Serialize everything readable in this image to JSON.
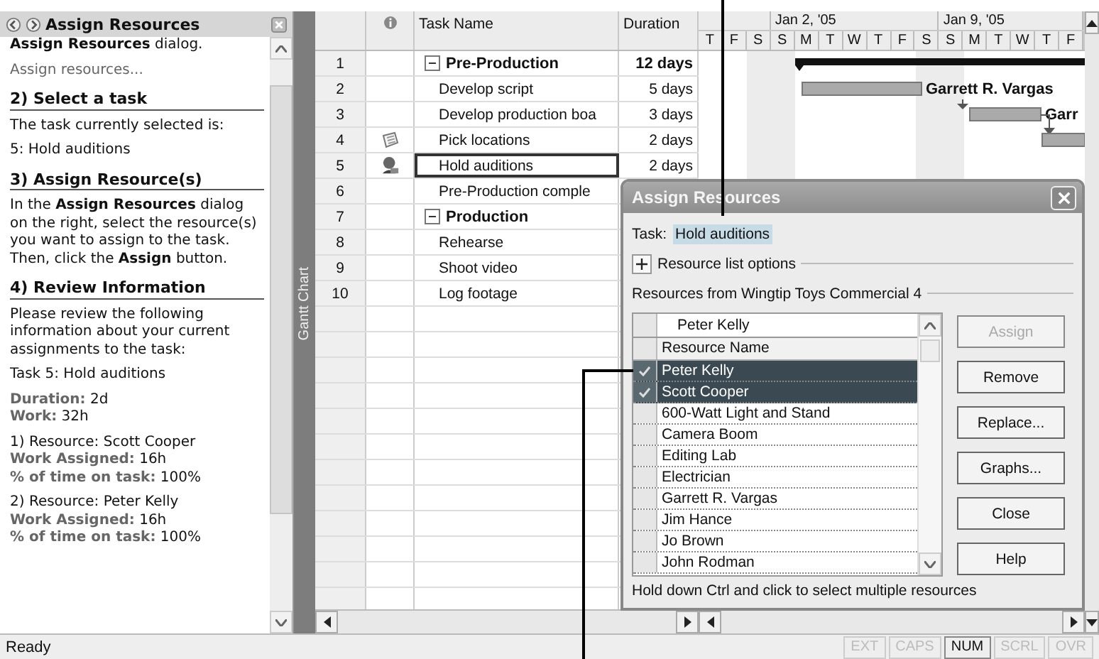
{
  "task_pane": {
    "title": "Assign Resources",
    "blocks": [
      {
        "kind": "text",
        "text": "**Assign Resources** dialog."
      },
      {
        "kind": "link",
        "text": "Assign resources..."
      },
      {
        "kind": "heading",
        "text": "2) Select a task"
      },
      {
        "kind": "text",
        "text": "The task currently selected is:"
      },
      {
        "kind": "text",
        "text": "5: Hold auditions"
      },
      {
        "kind": "heading",
        "text": "3) Assign Resource(s)"
      },
      {
        "kind": "text",
        "text": "In the **Assign Resources** dialog on the right, select the resource(s) you want to assign to the task. Then, click the **Assign** button."
      },
      {
        "kind": "heading",
        "text": "4) Review Information"
      },
      {
        "kind": "text",
        "text": "Please review the following information about your current assignments to the task:"
      },
      {
        "kind": "text",
        "text": "Task 5: Hold auditions"
      },
      {
        "kind": "lines",
        "lines": [
          "**Duration:** 2d",
          "**Work:** 32h"
        ]
      },
      {
        "kind": "lines",
        "lines": [
          "1) Resource: Scott Cooper",
          "**Work Assigned:** 16h",
          "**% of time on task:** 100%"
        ]
      },
      {
        "kind": "lines",
        "lines": [
          "2) Resource: Peter Kelly",
          "**Work Assigned:** 16h",
          "**% of time on task:** 100%"
        ]
      }
    ]
  },
  "view_bar": {
    "label": "Gantt Chart"
  },
  "table": {
    "columns": [
      "Task Name",
      "Duration"
    ],
    "rows": [
      {
        "id": "1",
        "kind": "summary",
        "name": "Pre-Production",
        "duration": "12 days",
        "expanded": true,
        "has_note": false,
        "has_assignment": false,
        "selected": false
      },
      {
        "id": "2",
        "kind": "task",
        "name": "Develop script",
        "duration": "5 days",
        "has_note": false,
        "has_assignment": false,
        "selected": false
      },
      {
        "id": "3",
        "kind": "task",
        "name": "Develop production boa",
        "duration": "3 days",
        "has_note": false,
        "has_assignment": false,
        "selected": false
      },
      {
        "id": "4",
        "kind": "task",
        "name": "Pick locations",
        "duration": "2 days",
        "has_note": true,
        "has_assignment": false,
        "selected": false
      },
      {
        "id": "5",
        "kind": "task",
        "name": "Hold auditions",
        "duration": "2 days",
        "has_note": false,
        "has_assignment": true,
        "selected": true
      },
      {
        "id": "6",
        "kind": "task",
        "name": "Pre-Production comple",
        "has_note": false,
        "has_assignment": false,
        "selected": false
      },
      {
        "id": "7",
        "kind": "summary",
        "name": "Production",
        "expanded": true,
        "has_note": false,
        "has_assignment": false,
        "selected": false
      },
      {
        "id": "8",
        "kind": "task",
        "name": "Rehearse",
        "has_note": false,
        "has_assignment": false,
        "selected": false
      },
      {
        "id": "9",
        "kind": "task",
        "name": "Shoot video",
        "has_note": false,
        "has_assignment": false,
        "selected": false
      },
      {
        "id": "10",
        "kind": "task",
        "name": "Log footage",
        "has_note": false,
        "has_assignment": false,
        "selected": false
      }
    ]
  },
  "timeline": {
    "weeks": [
      "Jan 2, '05",
      "Jan 9, '05"
    ],
    "days": [
      "T",
      "F",
      "S",
      "S",
      "M",
      "T",
      "W",
      "T",
      "F",
      "S",
      "S",
      "M",
      "T",
      "W",
      "T",
      "F"
    ],
    "bar_labels": [
      "Garrett R. Vargas",
      "Garr"
    ]
  },
  "dialog": {
    "title": "Assign Resources",
    "task_label": "Task:",
    "task_value": "Hold auditions",
    "options_label": "Resource list options",
    "resources_label": "Resources from Wingtip Toys Commercial 4",
    "entry_value": "Peter Kelly",
    "list_header": "Resource Name",
    "resources": [
      {
        "name": "Peter Kelly",
        "checked": true,
        "selected": true
      },
      {
        "name": "Scott Cooper",
        "checked": true,
        "selected": true
      },
      {
        "name": "600-Watt Light and Stand",
        "checked": false,
        "selected": false
      },
      {
        "name": "Camera Boom",
        "checked": false,
        "selected": false
      },
      {
        "name": "Editing Lab",
        "checked": false,
        "selected": false
      },
      {
        "name": "Electrician",
        "checked": false,
        "selected": false
      },
      {
        "name": "Garrett R. Vargas",
        "checked": false,
        "selected": false
      },
      {
        "name": "Jim Hance",
        "checked": false,
        "selected": false
      },
      {
        "name": "Jo Brown",
        "checked": false,
        "selected": false
      },
      {
        "name": "John Rodman",
        "checked": false,
        "selected": false
      }
    ],
    "buttons": [
      {
        "label": "Assign",
        "disabled": true
      },
      {
        "label": "Remove",
        "disabled": false
      },
      {
        "label": "Replace...",
        "disabled": false
      },
      {
        "label": "Graphs...",
        "disabled": false
      },
      {
        "label": "Close",
        "disabled": false
      },
      {
        "label": "Help",
        "disabled": false
      }
    ],
    "hint": "Hold down Ctrl and click to select multiple resources"
  },
  "status_bar": {
    "text": "Ready",
    "indicators": [
      {
        "label": "EXT",
        "on": false
      },
      {
        "label": "CAPS",
        "on": false
      },
      {
        "label": "NUM",
        "on": true
      },
      {
        "label": "SCRL",
        "on": false
      },
      {
        "label": "OVR",
        "on": false
      }
    ]
  }
}
